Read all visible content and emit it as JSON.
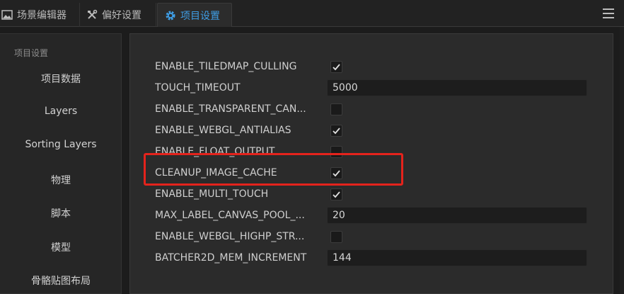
{
  "tabs": [
    {
      "label": "场景编辑器",
      "icon": "image-icon",
      "active": false
    },
    {
      "label": "偏好设置",
      "icon": "tools-icon",
      "active": false
    },
    {
      "label": "项目设置",
      "icon": "gear-icon",
      "active": true
    }
  ],
  "sidebar": {
    "section_title": "项目设置",
    "items": [
      "项目数据",
      "Layers",
      "Sorting Layers",
      "物理",
      "脚本",
      "模型",
      "骨骼贴图布局"
    ]
  },
  "settings": [
    {
      "name": "ENABLE_TILEDMAP_CULLING",
      "type": "checkbox",
      "checked": true
    },
    {
      "name": "TOUCH_TIMEOUT",
      "type": "number",
      "value": "5000"
    },
    {
      "name": "ENABLE_TRANSPARENT_CAN...",
      "type": "checkbox",
      "checked": false
    },
    {
      "name": "ENABLE_WEBGL_ANTIALIAS",
      "type": "checkbox",
      "checked": true
    },
    {
      "name": "ENABLE_FLOAT_OUTPUT",
      "type": "checkbox",
      "checked": false
    },
    {
      "name": "CLEANUP_IMAGE_CACHE",
      "type": "checkbox",
      "checked": true
    },
    {
      "name": "ENABLE_MULTI_TOUCH",
      "type": "checkbox",
      "checked": true
    },
    {
      "name": "MAX_LABEL_CANVAS_POOL_...",
      "type": "number",
      "value": "20"
    },
    {
      "name": "ENABLE_WEBGL_HIGHP_STR...",
      "type": "checkbox",
      "checked": false
    },
    {
      "name": "BATCHER2D_MEM_INCREMENT",
      "type": "number",
      "value": "144"
    }
  ],
  "colors": {
    "accent": "#3f9ee6",
    "highlight": "#e4231c",
    "background": "#1c1c1c"
  }
}
